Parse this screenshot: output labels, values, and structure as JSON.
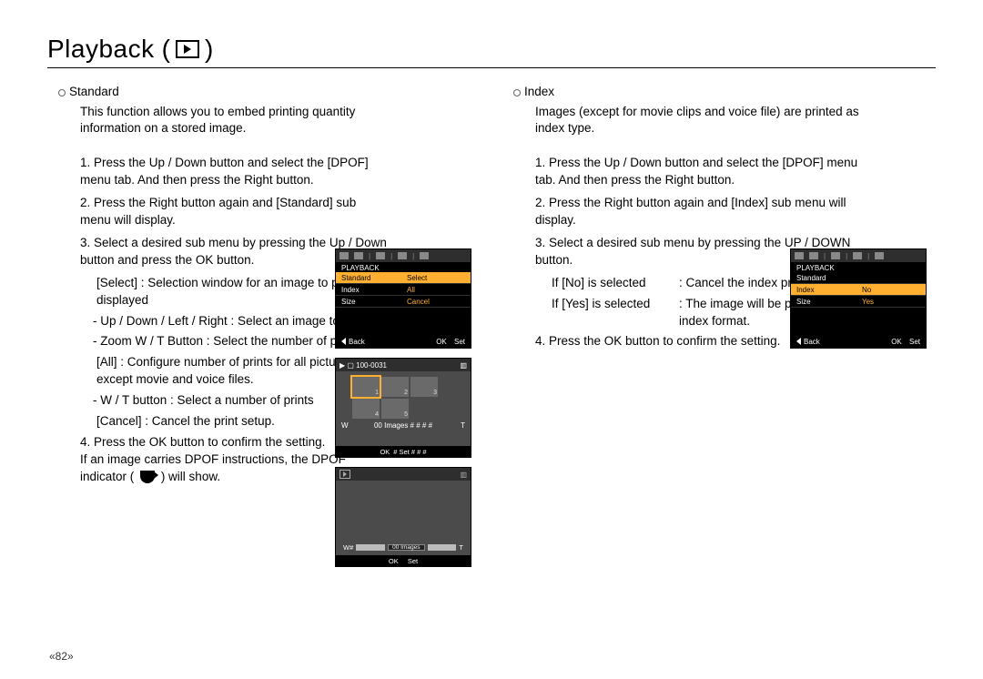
{
  "title": "Playback",
  "page_number": "«82»",
  "standard": {
    "heading": "Standard",
    "intro": "This function allows you to embed printing quantity information on a stored image.",
    "step1": "1. Press the Up / Down button and select the [DPOF] menu tab. And then press the Right button.",
    "step2": "2. Press the Right button again and [Standard] sub menu will display.",
    "step3": "3. Select a desired sub menu by pressing the Up / Down button and press the OK button.",
    "select": "[Select] : Selection window for an image to print is displayed",
    "updown": "- Up / Down / Left / Right : Select an image to print.",
    "zoom": "- Zoom W / T Button : Select the number of prints.",
    "all": "[All] : Configure number of prints for all pictures except movie and voice files.",
    "wt": "- W / T button : Select a number of prints",
    "cancel": "[Cancel] : Cancel the print setup.",
    "step4a": "4. Press the OK button to confirm the setting.",
    "step4b": "If an image carries DPOF instructions, the DPOF indicator (",
    "step4c": ") will show."
  },
  "index": {
    "heading": "Index",
    "intro": "Images (except for movie clips and voice file) are printed as index type.",
    "step1": "1. Press the Up / Down button and select the [DPOF] menu tab. And then press the Right button.",
    "step2": "2. Press the Right button again and [Index] sub menu will display.",
    "step3": "3. Select a desired sub menu by pressing the UP / DOWN button.",
    "no_label": "If [No] is selected",
    "no_val": ": Cancel the index print setting.",
    "yes_label": "If [Yes] is selected",
    "yes_val": ": The image will be printed in index format.",
    "step4": "4. Press the OK button to confirm the setting."
  },
  "screen_standard": {
    "menu_title": "PLAYBACK",
    "row1_l": "Standard",
    "row1_v": "Select",
    "row2_l": "Index",
    "row2_v": "All",
    "row3_l": "Size",
    "row3_v": "Cancel",
    "back": "Back",
    "set": "Set",
    "ok": "OK"
  },
  "screen_index": {
    "menu_title": "PLAYBACK",
    "row1_l": "Standard",
    "row1_v": "",
    "row2_l": "Index",
    "row2_v": "No",
    "row3_l": "Size",
    "row3_v": "Yes",
    "back": "Back",
    "set": "Set",
    "ok": "OK"
  },
  "screen_grid": {
    "file": "100-0031",
    "info": "00 Images # # # #",
    "foot1": "# Set # # #",
    "w": "W",
    "t": "T",
    "ok": "OK"
  },
  "screen_all": {
    "mid": "00 Images",
    "w": "W#",
    "t": "T",
    "ok": "OK",
    "set": "Set"
  }
}
